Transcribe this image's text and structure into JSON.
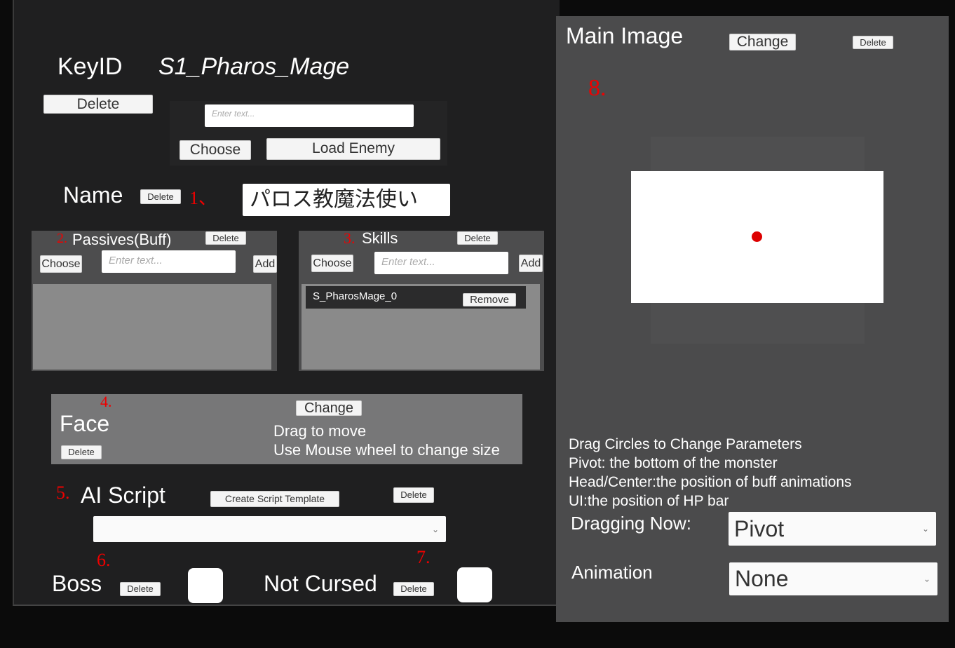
{
  "editor": {
    "keyid_label": "KeyID",
    "keyid_value": "S1_Pharos_Mage",
    "keyid_delete": "Delete",
    "load_input_placeholder": "Enter text...",
    "choose": "Choose",
    "load_enemy": "Load Enemy",
    "name_label": "Name",
    "name_delete": "Delete",
    "name_value": "パロス教魔法使い",
    "passives": {
      "title": "Passives(Buff)",
      "delete": "Delete",
      "choose": "Choose",
      "placeholder": "Enter text...",
      "add": "Add",
      "items": []
    },
    "skills": {
      "title": "Skills",
      "delete": "Delete",
      "choose": "Choose",
      "placeholder": "Enter text...",
      "add": "Add",
      "items": [
        {
          "name": "S_PharosMage_0",
          "remove": "Remove"
        }
      ]
    },
    "face": {
      "title": "Face",
      "change": "Change",
      "delete": "Delete",
      "hint1": "Drag to move",
      "hint2": "Use Mouse wheel to change size"
    },
    "ai_script": {
      "title": "AI Script",
      "create_template": "Create Script Template",
      "delete": "Delete",
      "selected": ""
    },
    "boss": {
      "label": "Boss",
      "delete": "Delete",
      "checked": false
    },
    "not_cursed": {
      "label": "Not Cursed",
      "delete": "Delete",
      "checked": false
    }
  },
  "annotations": [
    "1、",
    "2.",
    "3.",
    "4.",
    "5.",
    "6.",
    "7.",
    "8."
  ],
  "image_panel": {
    "title": "Main Image",
    "change": "Change",
    "delete": "Delete",
    "help": [
      "Drag Circles to Change Parameters",
      "Pivot: the bottom of the monster",
      "Head/Center:the position of buff animations",
      "UI:the position of HP bar"
    ],
    "dragging_label": "Dragging Now:",
    "dragging_value": "Pivot",
    "animation_label": "Animation",
    "animation_value": "None"
  },
  "colors": {
    "pivot_dot": "#dd0000",
    "annotation": "#ee0000"
  }
}
